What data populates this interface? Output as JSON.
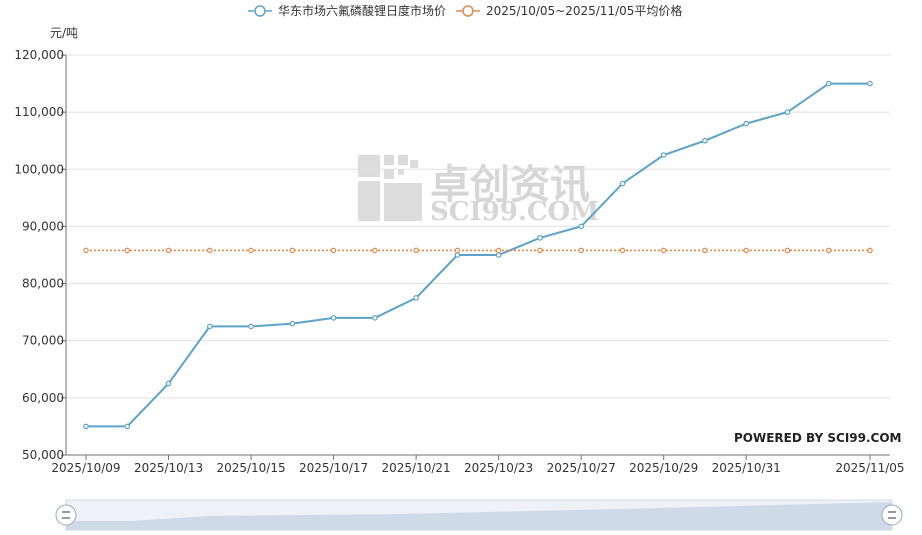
{
  "chart_data": {
    "type": "line",
    "ylabel": "元/吨",
    "ylim": [
      50000,
      120000
    ],
    "yticks": [
      "50,000",
      "60,000",
      "70,000",
      "80,000",
      "90,000",
      "100,000",
      "110,000",
      "120,000"
    ],
    "x": [
      "2025/10/09",
      "2025/10/10",
      "2025/10/13",
      "2025/10/14",
      "2025/10/15",
      "2025/10/16",
      "2025/10/17",
      "2025/10/20",
      "2025/10/21",
      "2025/10/22",
      "2025/10/23",
      "2025/10/24",
      "2025/10/27",
      "2025/10/28",
      "2025/10/29",
      "2025/10/30",
      "2025/10/31",
      "2025/11/03",
      "2025/11/04",
      "2025/11/05"
    ],
    "xtick_labels": [
      "2025/10/09",
      "2025/10/13",
      "2025/10/15",
      "2025/10/17",
      "2025/10/21",
      "2025/10/23",
      "2025/10/27",
      "2025/10/29",
      "2025/10/31",
      "2025/11/05"
    ],
    "series": [
      {
        "name": "华东市场六氟磷酸锂日度市场价",
        "color": "#5ba3c9",
        "values": [
          55000,
          55000,
          62500,
          72500,
          72500,
          73000,
          74000,
          74000,
          77500,
          85000,
          85000,
          88000,
          90000,
          97500,
          102500,
          105000,
          108000,
          110000,
          115000,
          115000
        ]
      },
      {
        "name": "2025/10/05~2025/11/05平均价格",
        "color": "#e08a4a",
        "values": [
          85800,
          85800,
          85800,
          85800,
          85800,
          85800,
          85800,
          85800,
          85800,
          85800,
          85800,
          85800,
          85800,
          85800,
          85800,
          85800,
          85800,
          85800,
          85800,
          85800
        ]
      }
    ],
    "grid": true,
    "legend": "top-center"
  },
  "watermark": {
    "cn": "卓创资讯",
    "en": "SCI99.COM",
    "powered": "POWERED BY SCI99.COM"
  },
  "datazoom": {
    "left_handle": "handle-icon",
    "right_handle": "handle-icon"
  }
}
